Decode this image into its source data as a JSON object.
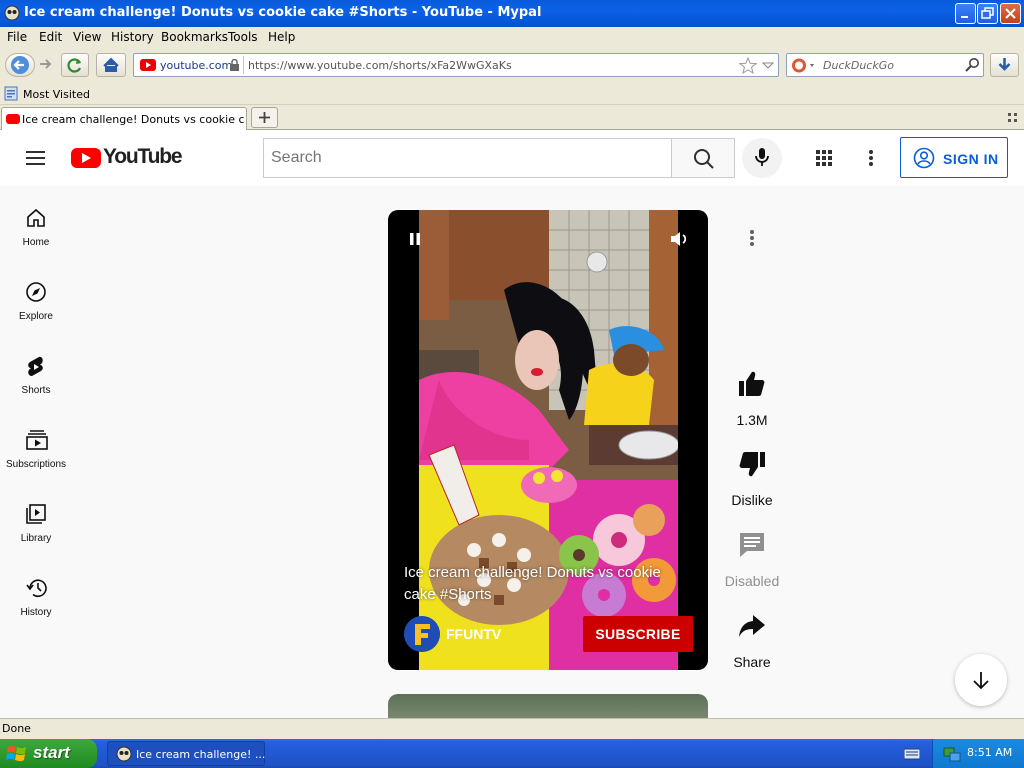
{
  "window": {
    "title": "Ice cream challenge! Donuts vs cookie cake #Shorts - YouTube - Mypal"
  },
  "menu": [
    "File",
    "Edit",
    "View",
    "History",
    "Bookmarks",
    "Tools",
    "Help"
  ],
  "nav": {
    "site_label": "youtube.com",
    "url": "https://www.youtube.com/shorts/xFa2WwGXaKs",
    "search_placeholder": "DuckDuckGo"
  },
  "bookmarks": {
    "most_visited": "Most Visited"
  },
  "tabs": [
    {
      "label": "Ice cream challenge! Donuts vs cookie cake ..."
    }
  ],
  "youtube": {
    "logo_text": "YouTube",
    "search_placeholder": "Search",
    "sign_in": "SIGN IN",
    "sidebar": [
      {
        "label": "Home",
        "icon": "home-icon"
      },
      {
        "label": "Explore",
        "icon": "compass-icon"
      },
      {
        "label": "Shorts",
        "icon": "shorts-icon"
      },
      {
        "label": "Subscriptions",
        "icon": "subscriptions-icon"
      },
      {
        "label": "Library",
        "icon": "library-icon"
      },
      {
        "label": "History",
        "icon": "history-icon"
      }
    ],
    "video": {
      "title": "Ice cream challenge! Donuts vs cookie cake #Shorts",
      "channel": "FFUNTV",
      "subscribe": "SUBSCRIBE"
    },
    "actions": {
      "likes": "1.3M",
      "dislike": "Dislike",
      "comments": "Disabled",
      "share": "Share"
    }
  },
  "status": {
    "text": "Done"
  },
  "taskbar": {
    "start": "start",
    "item": "Ice cream challenge! ...",
    "clock": "8:51 AM"
  },
  "colors": {
    "yt_red": "#ff0000",
    "subscribe_red": "#cc0000",
    "link_blue": "#065fd4",
    "xp_blue": "#0a5bdc",
    "xp_green": "#3fa83f"
  }
}
